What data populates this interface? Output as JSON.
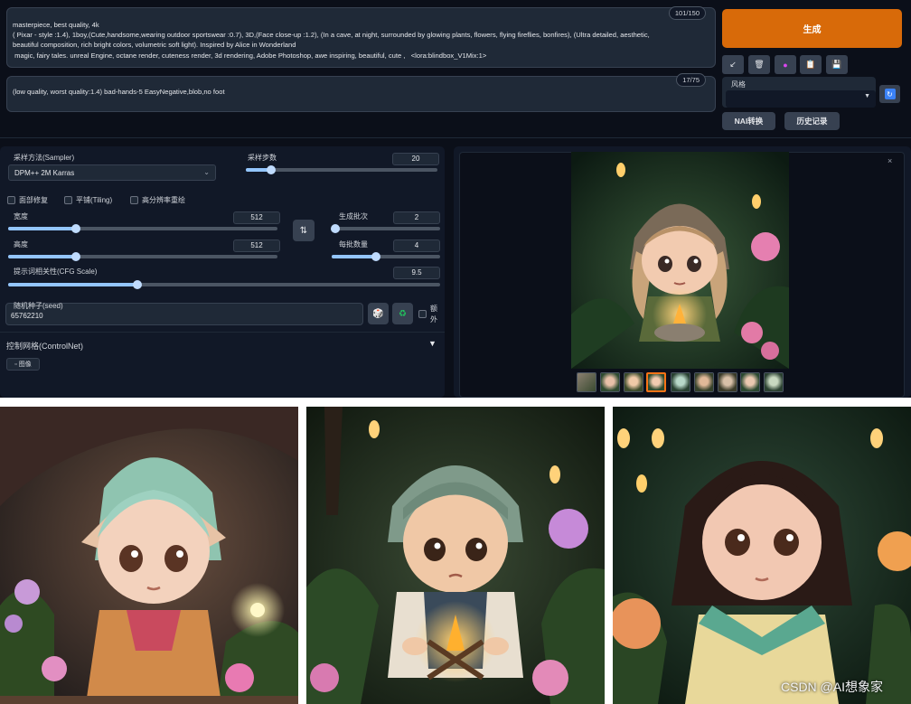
{
  "prompt": {
    "positive": "masterpiece, best quality, 4k\n( Pixar - style :1.4), 1boy,(Cute,handsome,wearing outdoor sportswear :0.7), 3D,(Face close-up :1.2), (In a cave, at night, surrounded by glowing plants, flowers, flying fireflies, bonfires), (Ultra detailed, aesthetic,\nbeautiful composition, rich bright colors, volumetric soft light). Inspired by Alice in Wonderland\n magic, fairy tales. unreal Engine, octane render, cuteness render, 3d rendering, Adobe Photoshop, awe inspiring, beautiful, cute ,   <lora:blindbox_V1Mix:1>",
    "positive_count": "101/150",
    "negative": "(low quality, worst quality:1.4) bad-hands-5 EasyNegative,blob,no foot",
    "negative_count": "17/75"
  },
  "actions": {
    "generate": "生成",
    "tools": [
      {
        "icon": "arrow-icon",
        "glyph": "↙"
      },
      {
        "icon": "trash-icon",
        "glyph": "🗑"
      },
      {
        "icon": "model-icon",
        "glyph": "●"
      },
      {
        "icon": "clipboard-icon",
        "glyph": "📋"
      },
      {
        "icon": "save-icon",
        "glyph": "💾"
      }
    ],
    "style_label": "风格",
    "nai_convert": "NAI转换",
    "history": "历史记录"
  },
  "settings": {
    "sampler_label": "采样方法(Sampler)",
    "sampler_value": "DPM++ 2M Karras",
    "steps_label": "采样步数",
    "steps_value": "20",
    "steps_fraction": 0.13,
    "restore_faces": "面部修复",
    "tiling": "平铺(Tiling)",
    "hires_fix": "高分辨率重绘",
    "width_label": "宽度",
    "width_value": "512",
    "width_fraction": 0.25,
    "height_label": "高度",
    "height_value": "512",
    "height_fraction": 0.25,
    "swap_glyph": "⇅",
    "batch_count_label": "生成批次",
    "batch_count_value": "2",
    "batch_count_fraction": 0.03,
    "batch_size_label": "每批数量",
    "batch_size_value": "4",
    "batch_size_fraction": 0.41,
    "cfg_label": "提示词相关性(CFG Scale)",
    "cfg_value": "9.5",
    "cfg_fraction": 0.3,
    "seed_label": "随机种子(seed)",
    "seed_value": "65762210",
    "dice_glyph": "🎲",
    "recycle_glyph": "♻",
    "extra_label": "额外",
    "controlnet_label": "控制网格(ControlNet)",
    "controlnet_toggle": "▼",
    "image_tab": "图像"
  },
  "gallery": {
    "close_glyph": "×",
    "thumbnail_count": 9,
    "selected_index": 3
  },
  "watermark": "CSDN @AI想象家"
}
